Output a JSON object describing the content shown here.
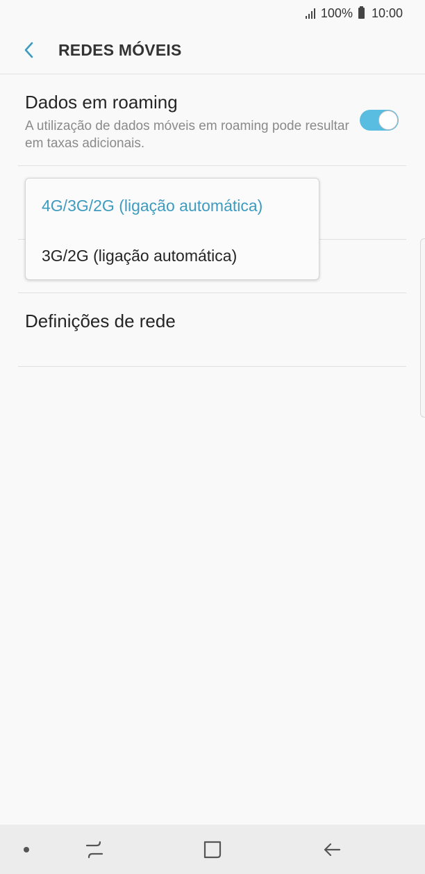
{
  "status_bar": {
    "battery_text": "100%",
    "time": "10:00"
  },
  "header": {
    "title": "REDES MÓVEIS"
  },
  "roaming": {
    "title": "Dados em roaming",
    "description": "A utilização de dados móveis em roaming pode resultar em taxas adicionais.",
    "enabled": true
  },
  "network_mode_menu": {
    "options": [
      {
        "label": "4G/3G/2G (ligação automática)",
        "selected": true
      },
      {
        "label": "3G/2G (ligação automática)",
        "selected": false
      }
    ]
  },
  "network_settings": {
    "label": "Definições de rede"
  },
  "colors": {
    "accent": "#59bde2",
    "selected_text": "#3d9bbf"
  },
  "icons": {
    "back": "chevron-left-icon",
    "signal": "signal-icon",
    "battery": "battery-icon",
    "nav_dot": "dot-icon",
    "recents": "recents-icon",
    "home": "home-icon",
    "nav_back": "back-arrow-icon"
  }
}
